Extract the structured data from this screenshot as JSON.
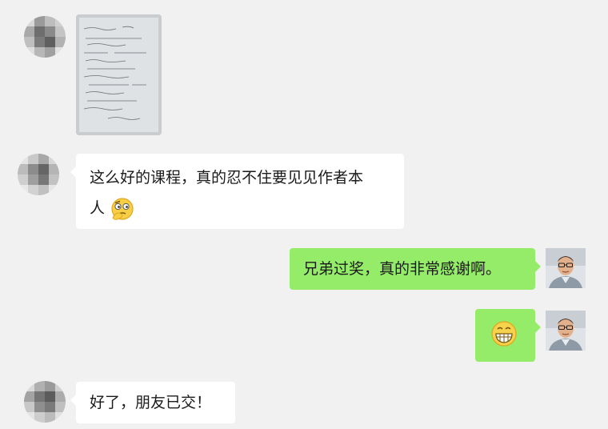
{
  "messages": [
    {
      "side": "left",
      "type": "image",
      "avatar": "mosaic-avatar",
      "content": "handwritten-notes-photo"
    },
    {
      "side": "left",
      "type": "text",
      "text_line1": "这么好的课程，真的忍不住要见见作者本",
      "text_line2": "人",
      "emoji": "thinking-emoji"
    },
    {
      "side": "right",
      "type": "text",
      "text": "兄弟过奖，真的非常感谢啊。",
      "avatar": "author-photo"
    },
    {
      "side": "right",
      "type": "emoji",
      "emoji": "grinning-emoji",
      "avatar": "author-photo"
    },
    {
      "side": "left",
      "type": "text",
      "text": "好了，朋友已交！",
      "avatar": "mosaic-avatar"
    }
  ],
  "colors": {
    "background": "#f1f1f1",
    "incoming_bubble": "#ffffff",
    "outgoing_bubble": "#95ec69"
  }
}
